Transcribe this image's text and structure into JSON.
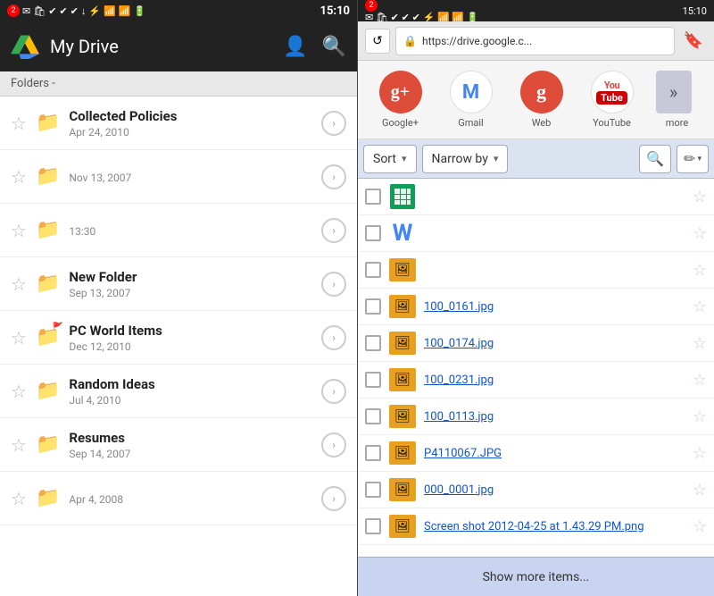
{
  "left": {
    "statusBar": {
      "badge": "2",
      "time": "15:10"
    },
    "header": {
      "title": "My Drive"
    },
    "foldersBar": "Folders -",
    "files": [
      {
        "name": "Collected Policies",
        "date": "Apr 24, 2010",
        "hasFlag": false
      },
      {
        "name": "",
        "date": "Nov 13, 2007",
        "hasFlag": false
      },
      {
        "name": "",
        "date": "13:30",
        "hasFlag": false
      },
      {
        "name": "New Folder",
        "date": "Sep 13, 2007",
        "hasFlag": false
      },
      {
        "name": "PC World Items",
        "date": "Dec 12, 2010",
        "hasFlag": true
      },
      {
        "name": "Random Ideas",
        "date": "Jul 4, 2010",
        "hasFlag": false
      },
      {
        "name": "Resumes",
        "date": "Sep 14, 2007",
        "hasFlag": false
      },
      {
        "name": "",
        "date": "Apr 4, 2008",
        "hasFlag": false
      }
    ]
  },
  "right": {
    "statusBar": {
      "badge": "2",
      "time": "15:10"
    },
    "urlBar": {
      "url": "https://drive.google.c..."
    },
    "nav": {
      "items": [
        {
          "id": "google-plus",
          "label": "Google+"
        },
        {
          "id": "gmail",
          "label": "Gmail"
        },
        {
          "id": "web",
          "label": "Web"
        },
        {
          "id": "youtube",
          "label": "YouTube"
        },
        {
          "id": "more",
          "label": "more"
        }
      ]
    },
    "sortBar": {
      "sortLabel": "Sort",
      "narrowLabel": "Narrow by"
    },
    "files": [
      {
        "name": "",
        "type": "sheets",
        "isLink": false
      },
      {
        "name": "",
        "type": "docs",
        "isLink": false
      },
      {
        "name": "",
        "type": "image",
        "isLink": false
      },
      {
        "name": "100_0161.jpg",
        "type": "image",
        "isLink": true
      },
      {
        "name": "100_0174.jpg",
        "type": "image",
        "isLink": true
      },
      {
        "name": "100_0231.jpg",
        "type": "image",
        "isLink": true
      },
      {
        "name": "100_0113.jpg",
        "type": "image",
        "isLink": true
      },
      {
        "name": "P4110067.JPG",
        "type": "image",
        "isLink": true
      },
      {
        "name": "000_0001.jpg",
        "type": "image",
        "isLink": true
      },
      {
        "name": "Screen shot 2012-04-25 at 1.43.29 PM.png",
        "type": "image",
        "isLink": true
      }
    ],
    "showMore": "Show more items..."
  }
}
